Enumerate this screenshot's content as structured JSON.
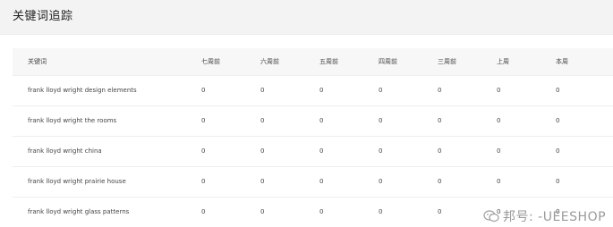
{
  "page": {
    "title": "关键词追踪"
  },
  "table": {
    "headers": [
      "关键词",
      "七周前",
      "六周前",
      "五周前",
      "四周前",
      "三周前",
      "上周",
      "本周"
    ],
    "rows": [
      {
        "keyword": "frank lloyd wright design elements",
        "values": [
          "0",
          "0",
          "0",
          "0",
          "0",
          "0",
          "0"
        ]
      },
      {
        "keyword": "frank lloyd wright the rooms",
        "values": [
          "0",
          "0",
          "0",
          "0",
          "0",
          "0",
          "0"
        ]
      },
      {
        "keyword": "frank lloyd wright china",
        "values": [
          "0",
          "0",
          "0",
          "0",
          "0",
          "0",
          "0"
        ]
      },
      {
        "keyword": "frank lloyd wright prairie house",
        "values": [
          "0",
          "0",
          "0",
          "0",
          "0",
          "0",
          "0"
        ]
      },
      {
        "keyword": "frank lloyd wright glass patterns",
        "values": [
          "0",
          "0",
          "0",
          "0",
          "0",
          "0",
          "0"
        ]
      }
    ]
  },
  "watermark": {
    "text": "邦号: -UEESHOP",
    "icon": "wechat-icon"
  },
  "colors": {
    "header_bg": "#f3f3f3",
    "table_header_bg": "#f7f7f7",
    "row_border": "#eeeeee",
    "watermark": "#9a9a9a"
  }
}
